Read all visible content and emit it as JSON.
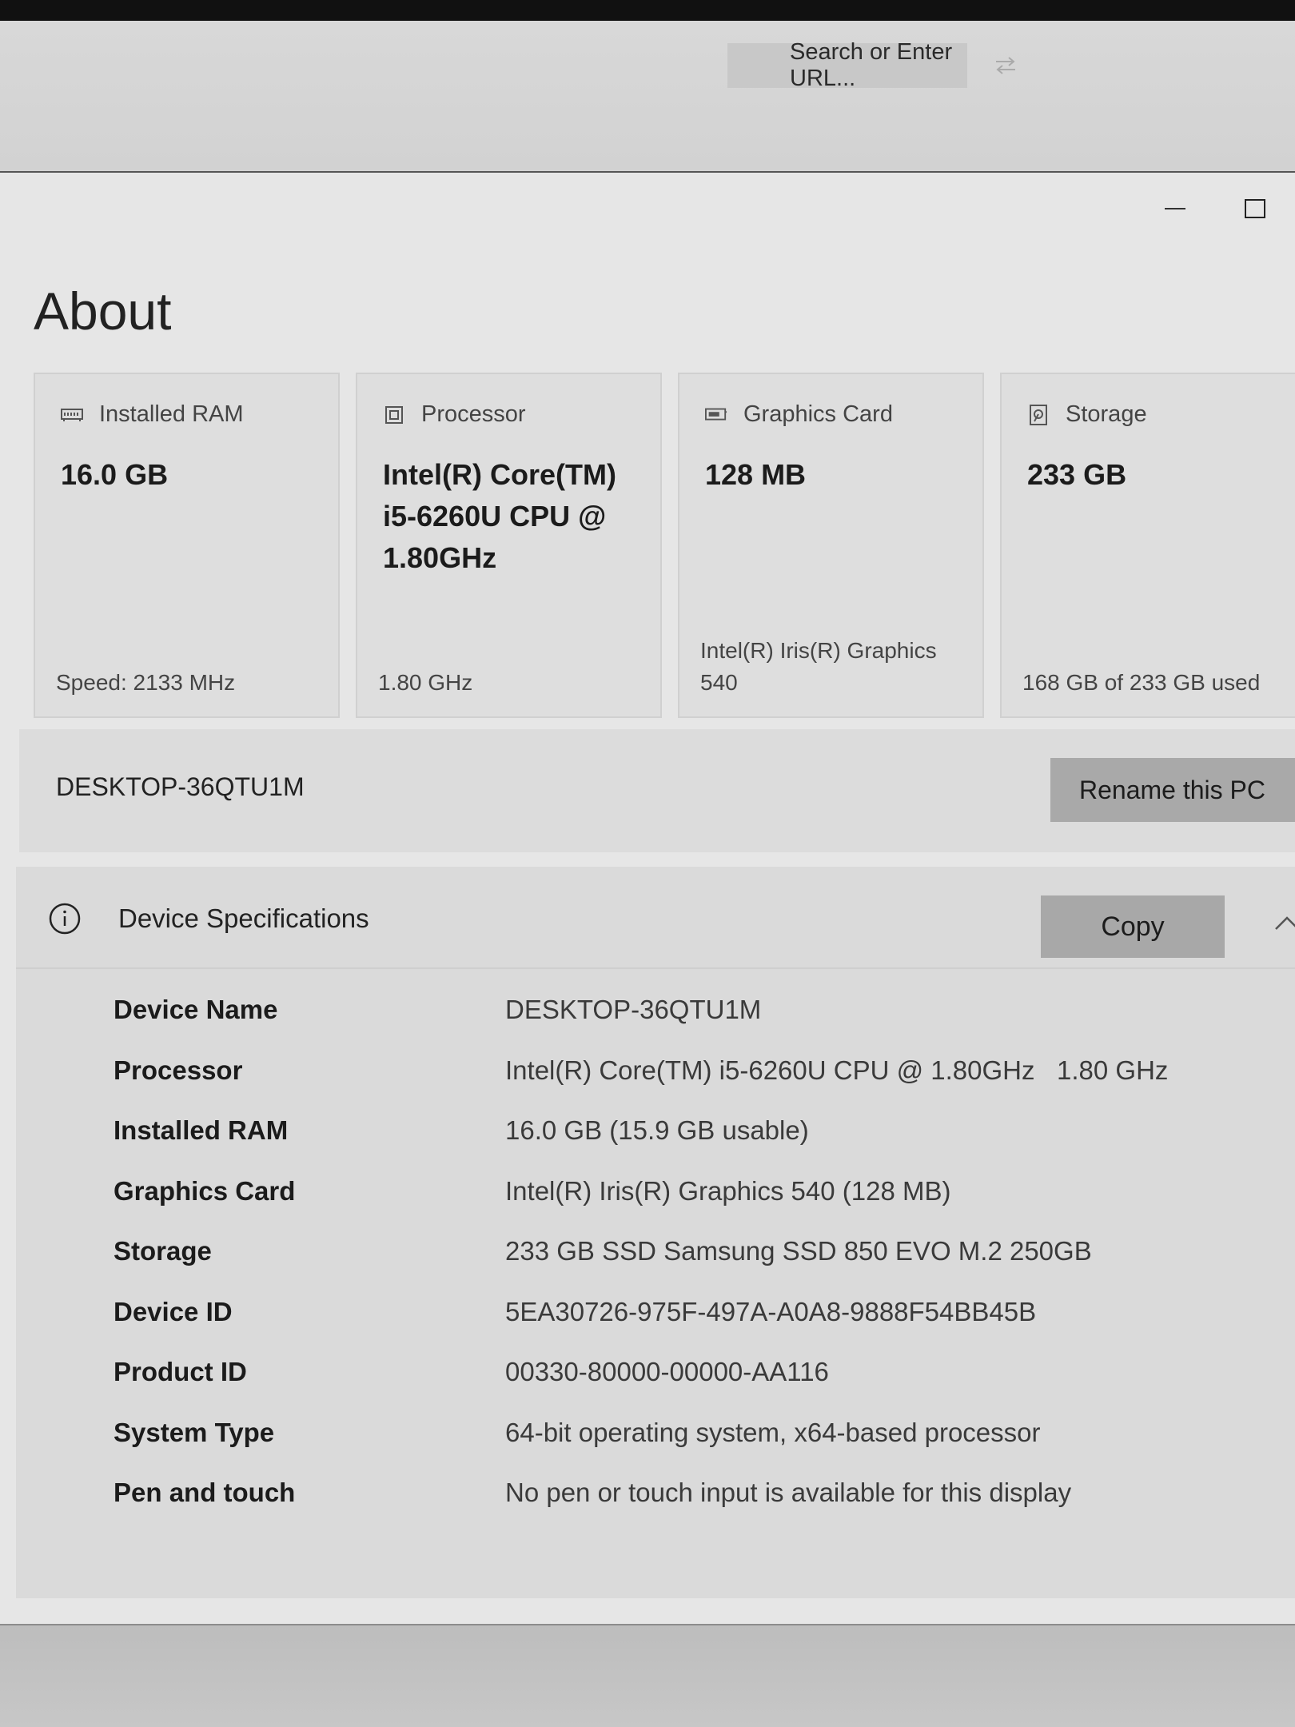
{
  "browser": {
    "url_placeholder": "Search or Enter URL..."
  },
  "window": {
    "title": "About"
  },
  "cards": [
    {
      "icon": "ram-icon",
      "label": "Installed RAM",
      "value": "16.0 GB",
      "footer": "Speed: 2133 MHz"
    },
    {
      "icon": "processor-icon",
      "label": "Processor",
      "value": "Intel(R) Core(TM) i5-6260U CPU @ 1.80GHz",
      "footer": "1.80 GHz"
    },
    {
      "icon": "graphics-card-icon",
      "label": "Graphics Card",
      "value": "128 MB",
      "footer": "Intel(R) Iris(R) Graphics 540"
    },
    {
      "icon": "storage-icon",
      "label": "Storage",
      "value": "233 GB",
      "footer": "168 GB of 233 GB used"
    }
  ],
  "rename": {
    "pc_name": "DESKTOP-36QTU1M",
    "button_label": "Rename this PC"
  },
  "specs": {
    "title": "Device Specifications",
    "copy_label": "Copy",
    "rows": [
      {
        "label": "Device Name",
        "value": "DESKTOP-36QTU1M"
      },
      {
        "label": "Processor",
        "value": "Intel(R) Core(TM) i5-6260U CPU @ 1.80GHz   1.80 GHz"
      },
      {
        "label": "Installed RAM",
        "value": "16.0 GB (15.9 GB usable)"
      },
      {
        "label": "Graphics Card",
        "value": "Intel(R) Iris(R) Graphics 540 (128 MB)"
      },
      {
        "label": "Storage",
        "value": "233 GB SSD Samsung SSD 850 EVO M.2 250GB"
      },
      {
        "label": "Device ID",
        "value": "5EA30726-975F-497A-A0A8-9888F54BB45B"
      },
      {
        "label": "Product ID",
        "value": "00330-80000-00000-AA116"
      },
      {
        "label": "System Type",
        "value": "64-bit operating system, x64-based processor"
      },
      {
        "label": "Pen and touch",
        "value": "No pen or touch input is available for this display"
      }
    ]
  }
}
